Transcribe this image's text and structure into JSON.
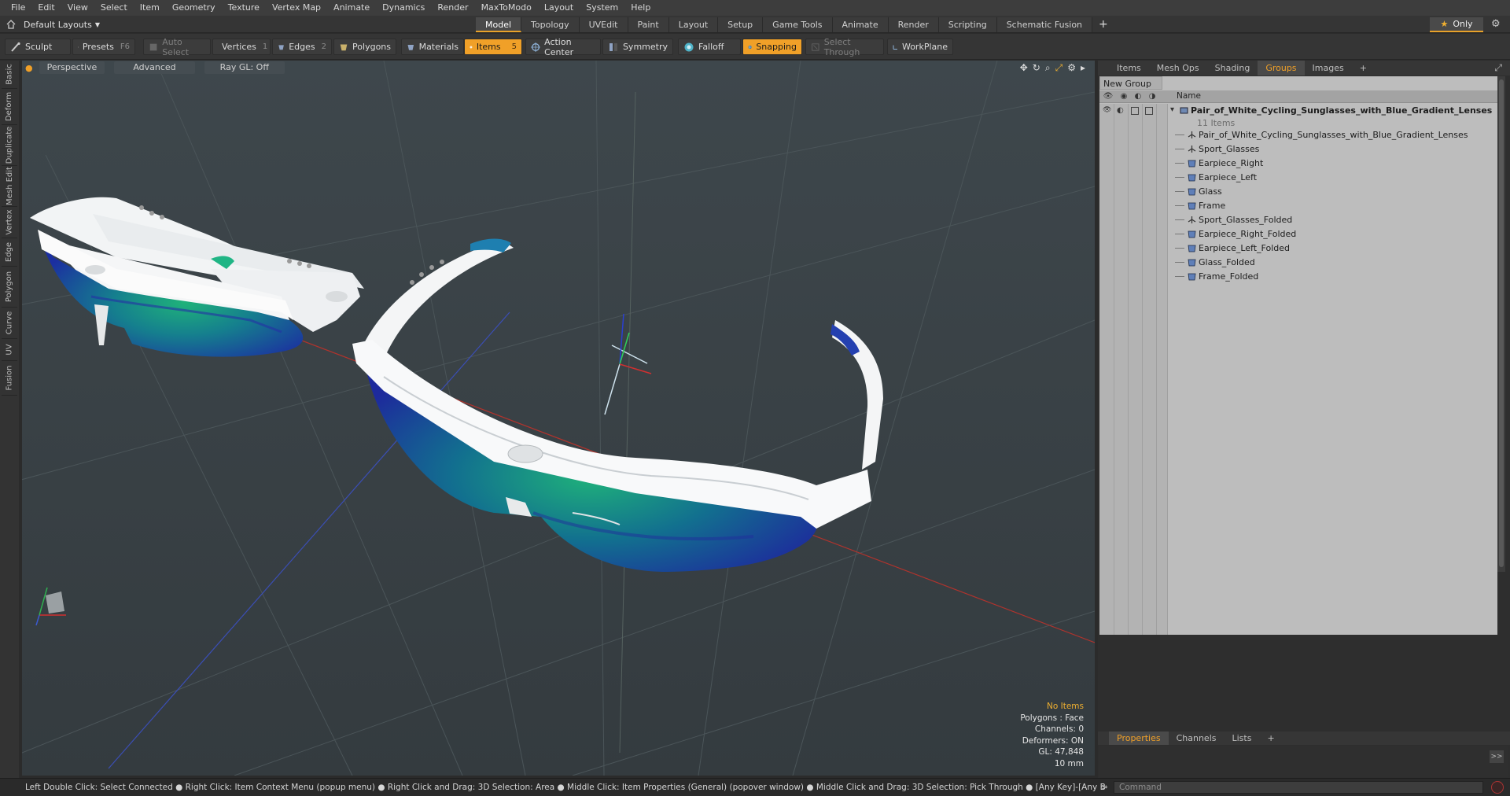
{
  "menu": [
    "File",
    "Edit",
    "View",
    "Select",
    "Item",
    "Geometry",
    "Texture",
    "Vertex Map",
    "Animate",
    "Dynamics",
    "Render",
    "MaxToModo",
    "Layout",
    "System",
    "Help"
  ],
  "layout_select": "Default Layouts",
  "tabs": [
    {
      "label": "Model",
      "active": true
    },
    {
      "label": "Topology",
      "active": false
    },
    {
      "label": "UVEdit",
      "active": false
    },
    {
      "label": "Paint",
      "active": false
    },
    {
      "label": "Layout",
      "active": false
    },
    {
      "label": "Setup",
      "active": false
    },
    {
      "label": "Game Tools",
      "active": false
    },
    {
      "label": "Animate",
      "active": false
    },
    {
      "label": "Render",
      "active": false
    },
    {
      "label": "Scripting",
      "active": false
    },
    {
      "label": "Schematic Fusion",
      "active": false
    }
  ],
  "tab_add": "+",
  "only_label": "Only",
  "toolbar": {
    "sculpt": "Sculpt",
    "presets": "Presets",
    "presets_key": "F6",
    "auto_select": "Auto Select",
    "vertices": "Vertices",
    "vertices_num": "1",
    "edges": "Edges",
    "edges_num": "2",
    "polygons": "Polygons",
    "materials": "Materials",
    "items": "Items",
    "items_num": "5",
    "action_center": "Action Center",
    "symmetry": "Symmetry",
    "falloff": "Falloff",
    "snapping": "Snapping",
    "select_through": "Select Through",
    "workplane": "WorkPlane"
  },
  "left_tabs": [
    "Basic",
    "Deform",
    "Duplicate",
    "Mesh Edit",
    "Vertex",
    "Edge",
    "Polygon",
    "Curve",
    "UV",
    "Fusion"
  ],
  "viewport": {
    "perspective": "Perspective",
    "advanced": "Advanced",
    "raygl": "Ray GL: Off",
    "hud": {
      "no_items": "No Items",
      "polygons": "Polygons : Face",
      "channels": "Channels: 0",
      "deformers": "Deformers: ON",
      "gl": "GL: 47,848",
      "unit": "10 mm"
    }
  },
  "right_tabs": [
    "Items",
    "Mesh Ops",
    "Shading",
    "Groups",
    "Images",
    "+"
  ],
  "right_active": "Groups",
  "groups": {
    "new_group": "New Group",
    "name_header": "Name",
    "root": "Pair_of_White_Cycling_Sunglasses_with_Blue_Gradient_Lenses",
    "count": "11 Items",
    "items": [
      {
        "label": "Pair_of_White_Cycling_Sunglasses_with_Blue_Gradient_Lenses",
        "icon": "locator"
      },
      {
        "label": "Sport_Glasses",
        "icon": "locator"
      },
      {
        "label": "Earpiece_Right",
        "icon": "mesh"
      },
      {
        "label": "Earpiece_Left",
        "icon": "mesh"
      },
      {
        "label": "Glass",
        "icon": "mesh"
      },
      {
        "label": "Frame",
        "icon": "mesh"
      },
      {
        "label": "Sport_Glasses_Folded",
        "icon": "locator"
      },
      {
        "label": "Earpiece_Right_Folded",
        "icon": "mesh"
      },
      {
        "label": "Earpiece_Left_Folded",
        "icon": "mesh"
      },
      {
        "label": "Glass_Folded",
        "icon": "mesh"
      },
      {
        "label": "Frame_Folded",
        "icon": "mesh"
      }
    ]
  },
  "props_tabs": [
    "Properties",
    "Channels",
    "Lists",
    "+"
  ],
  "props_active": "Properties",
  "props_arrow": ">>",
  "status": "Left Double Click: Select Connected ● Right Click: Item Context Menu (popup menu) ● Right Click and Drag: 3D Selection: Area ● Middle Click: Item Properties (General) (popover window) ● Middle Click and Drag: 3D Selection: Pick Through ● [Any Key]-[Any Button] Click and D…",
  "command_placeholder": "Command",
  "colors": {
    "accent": "#f0a028",
    "viewport_bg": "#3a4246",
    "panel_bg": "#bdbdbd",
    "lens_center": "#1fb27a",
    "lens_edge": "#1b2fa0",
    "frame": "#ffffff"
  }
}
